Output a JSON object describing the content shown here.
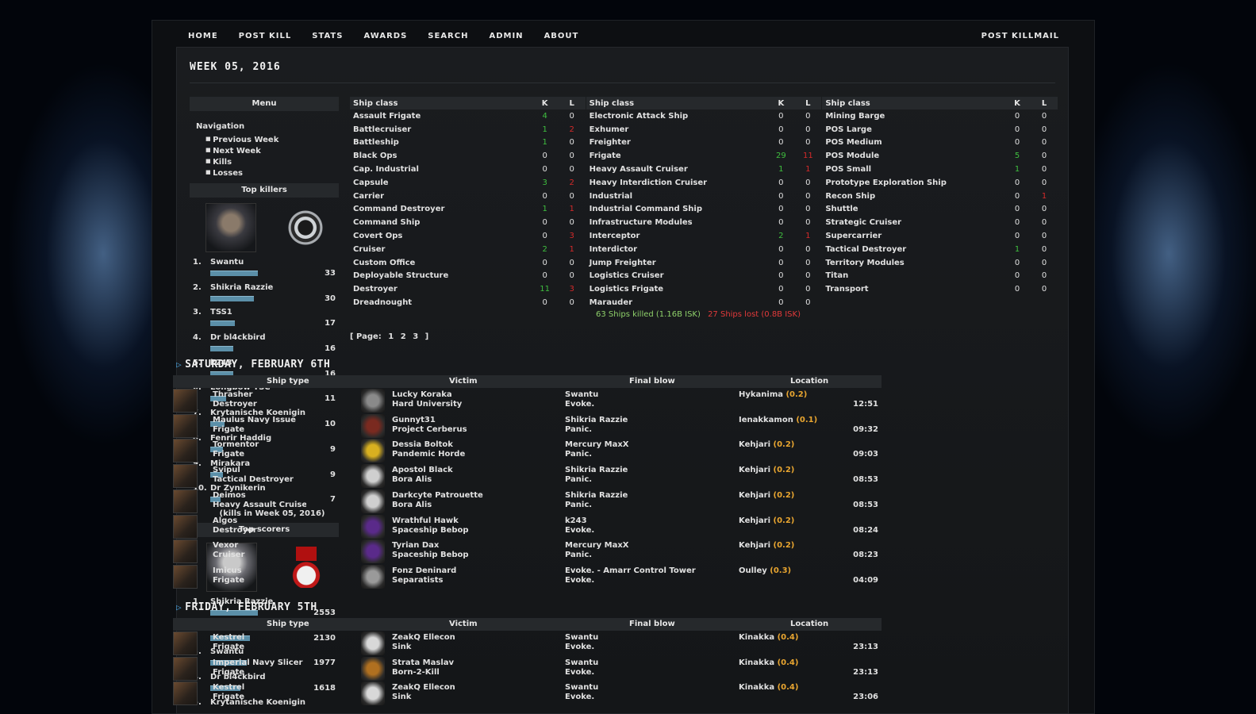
{
  "nav": {
    "items": [
      "HOME",
      "POST KILL",
      "STATS",
      "AWARDS",
      "SEARCH",
      "ADMIN",
      "ABOUT"
    ],
    "right": "POST KILLMAIL"
  },
  "page_title": "WEEK 05, 2016",
  "menu": {
    "title": "Menu",
    "nav_label": "Navigation",
    "links": [
      "Previous Week",
      "Next Week",
      "Kills",
      "Losses"
    ]
  },
  "top_killers": {
    "title": "Top killers",
    "max": 33,
    "entries": [
      {
        "rank": "1.",
        "name": "Swantu",
        "value": 33
      },
      {
        "rank": "2.",
        "name": "Shikria Razzie",
        "value": 30
      },
      {
        "rank": "3.",
        "name": "TSS1",
        "value": 17
      },
      {
        "rank": "4.",
        "name": "Dr bl4ckbird",
        "value": 16
      },
      {
        "rank": "5.",
        "name": "k243",
        "value": 16
      },
      {
        "rank": "6.",
        "name": "Longbow TSC",
        "value": 11
      },
      {
        "rank": "7.",
        "name": "Krytanische Koenigin",
        "value": 10
      },
      {
        "rank": "8.",
        "name": "Fenrir Haddig",
        "value": 9
      },
      {
        "rank": "9.",
        "name": "Mirakara",
        "value": 9
      },
      {
        "rank": "10.",
        "name": "Dr Zynikerin",
        "value": 7
      }
    ],
    "note": "(kills in Week 05, 2016)"
  },
  "top_scorers": {
    "title": "Top scorers",
    "max": 2553,
    "entries": [
      {
        "rank": "1.",
        "name": "Shikria Razzie",
        "value": 2553
      },
      {
        "rank": "2.",
        "name": "TSS1",
        "value": 2130
      },
      {
        "rank": "3.",
        "name": "Swantu",
        "value": 1977
      },
      {
        "rank": "4.",
        "name": "Dr bl4ckbird",
        "value": 1618
      },
      {
        "rank": "5.",
        "name": "Krytanische Koenigin",
        "value": null
      }
    ]
  },
  "ship_table": {
    "headers": {
      "class": "Ship class",
      "k": "K",
      "l": "L"
    },
    "columns": [
      [
        [
          "Assault Frigate",
          4,
          0
        ],
        [
          "Battlecruiser",
          1,
          2
        ],
        [
          "Battleship",
          1,
          0
        ],
        [
          "Black Ops",
          0,
          0
        ],
        [
          "Cap. Industrial",
          0,
          0
        ],
        [
          "Capsule",
          3,
          2
        ],
        [
          "Carrier",
          0,
          0
        ],
        [
          "Command Destroyer",
          1,
          1
        ],
        [
          "Command Ship",
          0,
          0
        ],
        [
          "Covert Ops",
          0,
          3
        ],
        [
          "Cruiser",
          2,
          1
        ],
        [
          "Custom Office",
          0,
          0
        ],
        [
          "Deployable Structure",
          0,
          0
        ],
        [
          "Destroyer",
          11,
          3
        ],
        [
          "Dreadnought",
          0,
          0
        ]
      ],
      [
        [
          "Electronic Attack Ship",
          0,
          0
        ],
        [
          "Exhumer",
          0,
          0
        ],
        [
          "Freighter",
          0,
          0
        ],
        [
          "Frigate",
          29,
          11
        ],
        [
          "Heavy Assault Cruiser",
          1,
          1
        ],
        [
          "Heavy Interdiction Cruiser",
          0,
          0
        ],
        [
          "Industrial",
          0,
          0
        ],
        [
          "Industrial Command Ship",
          0,
          0
        ],
        [
          "Infrastructure Modules",
          0,
          0
        ],
        [
          "Interceptor",
          2,
          1
        ],
        [
          "Interdictor",
          0,
          0
        ],
        [
          "Jump Freighter",
          0,
          0
        ],
        [
          "Logistics Cruiser",
          0,
          0
        ],
        [
          "Logistics Frigate",
          0,
          0
        ],
        [
          "Marauder",
          0,
          0
        ]
      ],
      [
        [
          "Mining Barge",
          0,
          0
        ],
        [
          "POS Large",
          0,
          0
        ],
        [
          "POS Medium",
          0,
          0
        ],
        [
          "POS Module",
          5,
          0
        ],
        [
          "POS Small",
          1,
          0
        ],
        [
          "Prototype Exploration Ship",
          0,
          0
        ],
        [
          "Recon Ship",
          0,
          1
        ],
        [
          "Shuttle",
          0,
          0
        ],
        [
          "Strategic Cruiser",
          0,
          0
        ],
        [
          "Supercarrier",
          0,
          0
        ],
        [
          "Tactical Destroyer",
          1,
          0
        ],
        [
          "Territory Modules",
          0,
          0
        ],
        [
          "Titan",
          0,
          0
        ],
        [
          "Transport",
          0,
          0
        ]
      ]
    ],
    "totals_killed": "63 Ships killed (1.16B ISK)",
    "totals_lost": "27 Ships lost (0.8B ISK)"
  },
  "pager": {
    "label": "[ Page:",
    "pages": [
      "1",
      "2",
      "3"
    ],
    "end": "]"
  },
  "kill_headers": {
    "ship": "Ship type",
    "victim": "Victim",
    "final": "Final blow",
    "location": "Location"
  },
  "days": [
    {
      "title": "SATURDAY, FEBRUARY 6TH",
      "kills": [
        {
          "ship": "Thrasher",
          "cls": "Destroyer",
          "victim": "Lucky Koraka",
          "vcorp": "Hard University",
          "fb": "Swantu",
          "fbcorp": "Evoke.",
          "sys": "Hykanima",
          "sec": "(0.2)",
          "time": "12:51"
        },
        {
          "ship": "Maulus Navy Issue",
          "cls": "Frigate",
          "victim": "Gunnyt31",
          "vcorp": "Project Cerberus",
          "fb": "Shikria Razzie",
          "fbcorp": "Panic.",
          "sys": "Ienakkamon",
          "sec": "(0.1)",
          "time": "09:32"
        },
        {
          "ship": "Tormentor",
          "cls": "Frigate",
          "victim": "Dessia Boltok",
          "vcorp": "Pandemic Horde",
          "fb": "Mercury MaxX",
          "fbcorp": "Panic.",
          "sys": "Kehjari",
          "sec": "(0.2)",
          "time": "09:03"
        },
        {
          "ship": "Svipul",
          "cls": "Tactical Destroyer",
          "victim": "Apostol Black",
          "vcorp": "Bora Alis",
          "fb": "Shikria Razzie",
          "fbcorp": "Panic.",
          "sys": "Kehjari",
          "sec": "(0.2)",
          "time": "08:53"
        },
        {
          "ship": "Deimos",
          "cls": "Heavy Assault Cruise",
          "victim": "Darkcyte Patrouette",
          "vcorp": "Bora Alis",
          "fb": "Shikria Razzie",
          "fbcorp": "Panic.",
          "sys": "Kehjari",
          "sec": "(0.2)",
          "time": "08:53"
        },
        {
          "ship": "Algos",
          "cls": "Destroyer",
          "victim": "Wrathful Hawk",
          "vcorp": "Spaceship Bebop",
          "fb": "k243",
          "fbcorp": "Evoke.",
          "sys": "Kehjari",
          "sec": "(0.2)",
          "time": "08:24"
        },
        {
          "ship": "Vexor",
          "cls": "Cruiser",
          "victim": "Tyrian Dax",
          "vcorp": "Spaceship Bebop",
          "fb": "Mercury MaxX",
          "fbcorp": "Panic.",
          "sys": "Kehjari",
          "sec": "(0.2)",
          "time": "08:23"
        },
        {
          "ship": "Imicus",
          "cls": "Frigate",
          "victim": "Fonz Deninard",
          "vcorp": "Separatists",
          "fb": "Evoke. - Amarr Control Tower",
          "fbcorp": "Evoke.",
          "sys": "Oulley",
          "sec": "(0.3)",
          "time": "04:09"
        }
      ]
    },
    {
      "title": "FRIDAY, FEBRUARY 5TH",
      "kills": [
        {
          "ship": "Kestrel",
          "cls": "Frigate",
          "victim": "ZeakQ Ellecon",
          "vcorp": "Sink",
          "fb": "Swantu",
          "fbcorp": "Evoke.",
          "sys": "Kinakka",
          "sec": "(0.4)",
          "time": "23:13"
        },
        {
          "ship": "Imperial Navy Slicer",
          "cls": "Frigate",
          "victim": "Strata Maslav",
          "vcorp": "Born-2-Kill",
          "fb": "Swantu",
          "fbcorp": "Evoke.",
          "sys": "Kinakka",
          "sec": "(0.4)",
          "time": "23:13"
        },
        {
          "ship": "Kestrel",
          "cls": "Frigate",
          "victim": "ZeakQ Ellecon",
          "vcorp": "Sink",
          "fb": "Swantu",
          "fbcorp": "Evoke.",
          "sys": "Kinakka",
          "sec": "(0.4)",
          "time": "23:06"
        }
      ]
    }
  ]
}
